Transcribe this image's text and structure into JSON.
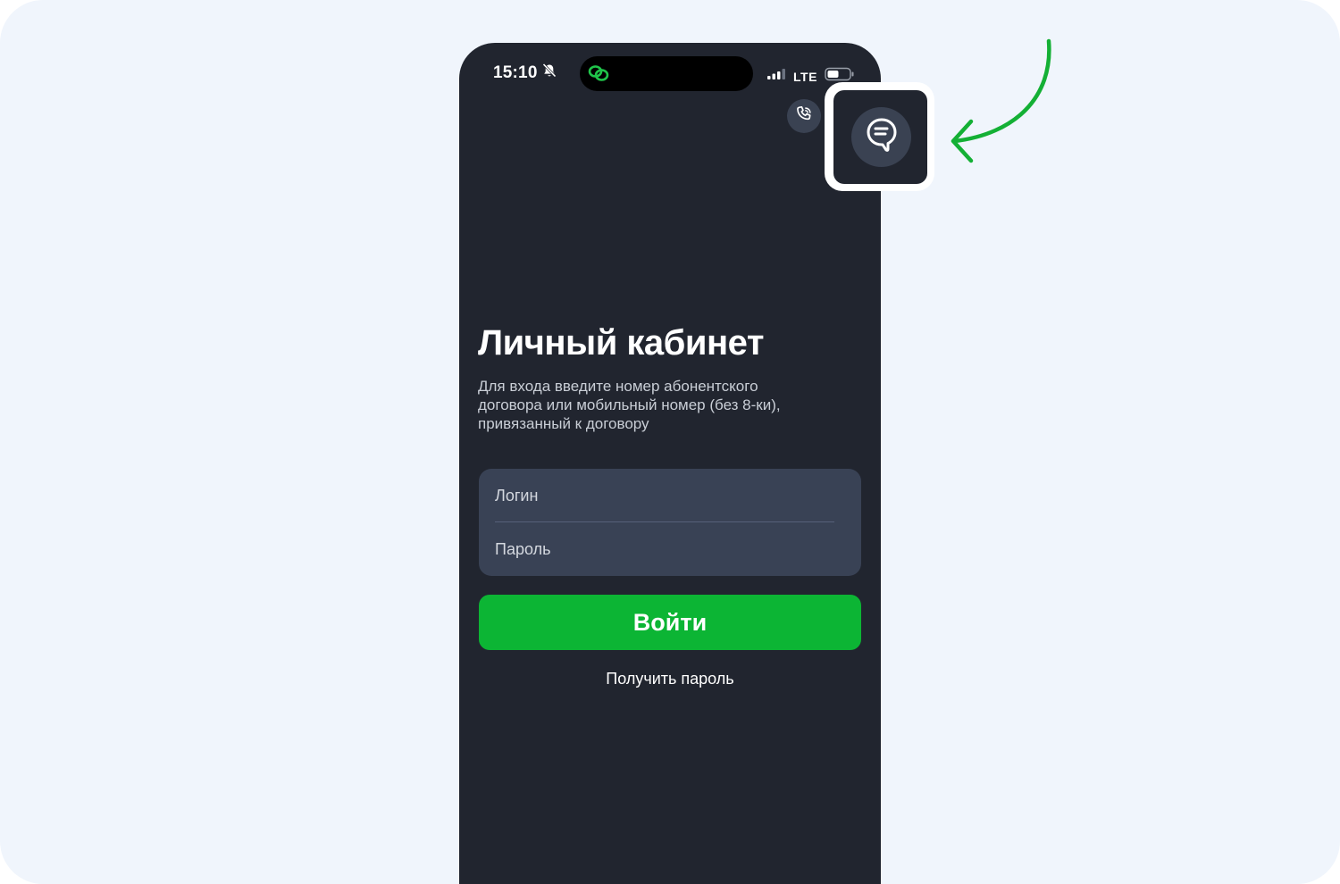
{
  "status_bar": {
    "time": "15:10",
    "network": "LTE",
    "icons": [
      "bell-muted-icon",
      "chain-link-icon",
      "signal-icon",
      "battery-icon"
    ]
  },
  "header_actions": {
    "call_icon": "phone-icon",
    "chat_icon": "chat-bubble-icon"
  },
  "login": {
    "title": "Личный кабинет",
    "description_lines": [
      "Для входа введите номер абонентского",
      "договора или мобильный номер (без 8-ки),",
      "привязанный к договору"
    ],
    "login_placeholder": "Логин",
    "password_placeholder": "Пароль",
    "submit_label": "Войти",
    "get_password_label": "Получить пароль"
  },
  "colors": {
    "background": "#f0f5fc",
    "phone": "#21252f",
    "field": "#394255",
    "accent_green": "#0cb534",
    "arrow_green": "#14b035"
  }
}
